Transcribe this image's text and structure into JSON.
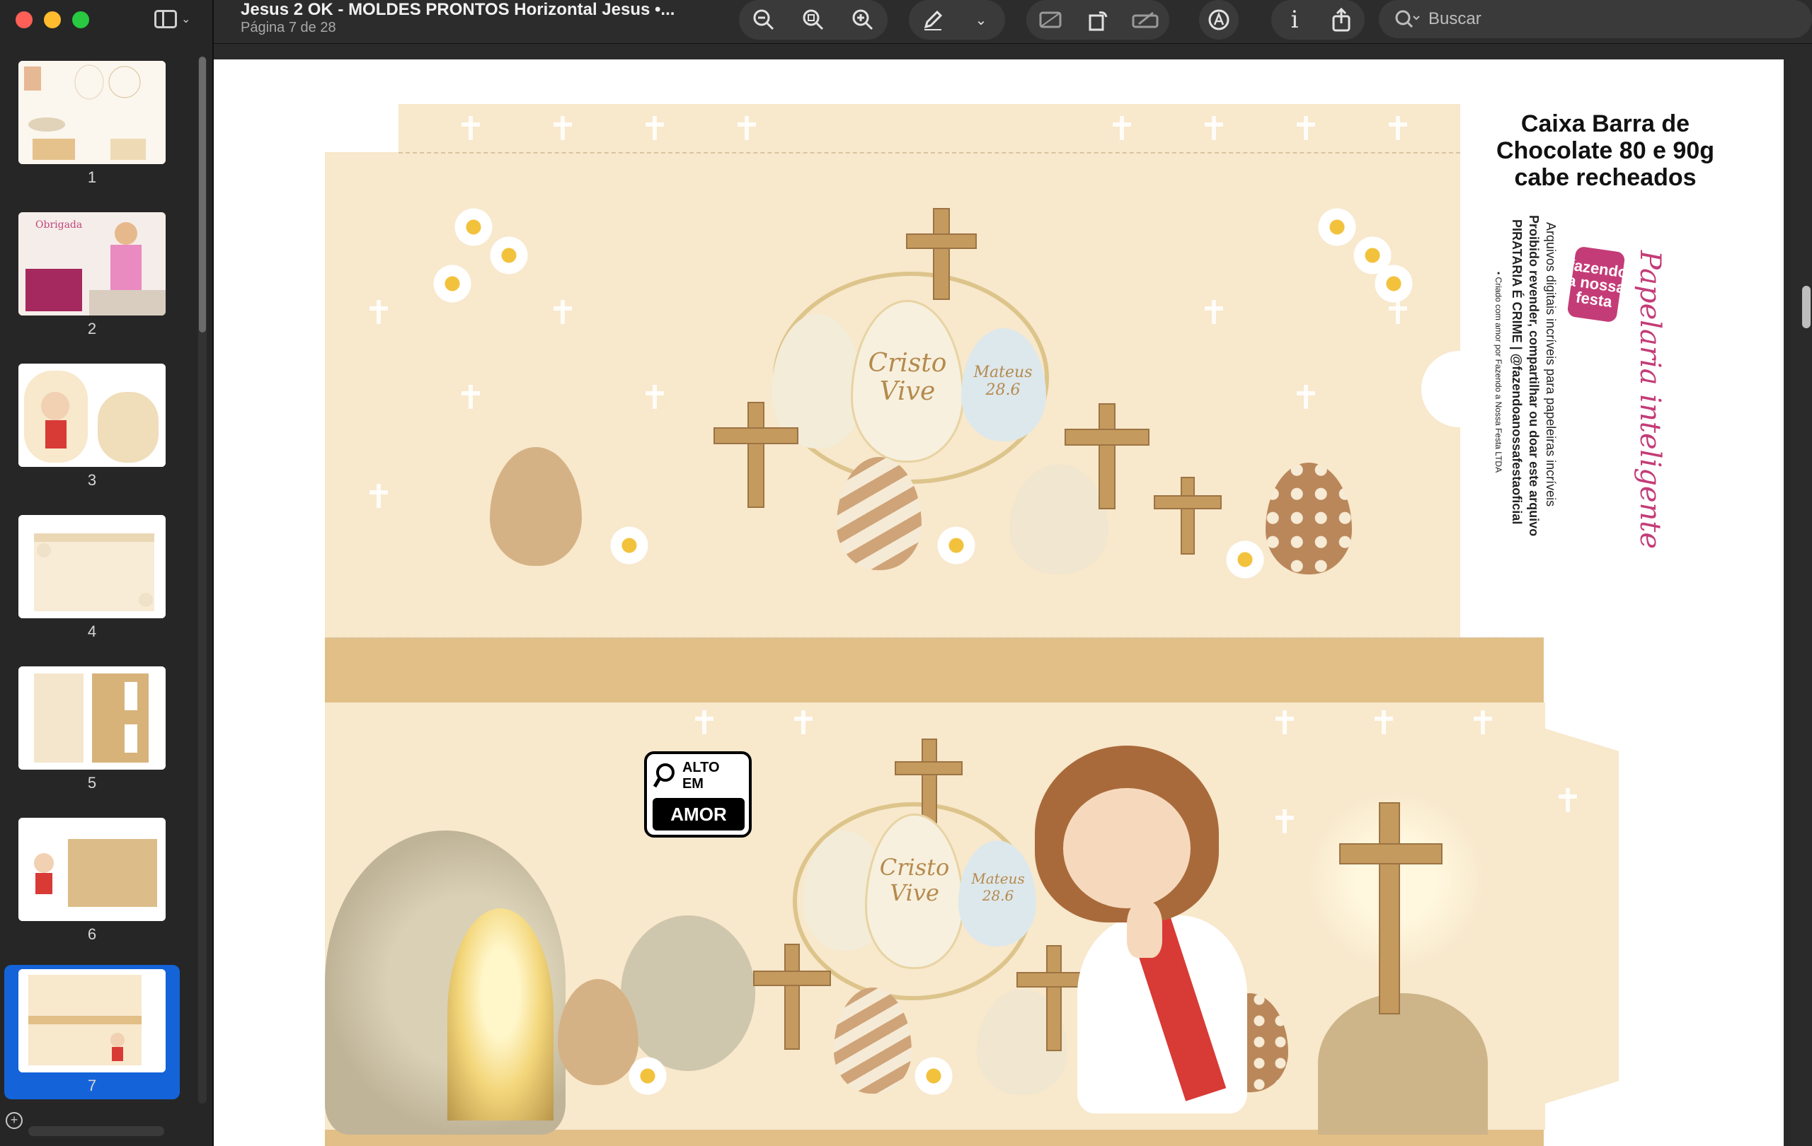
{
  "window": {
    "title": "Jesus 2 OK - MOLDES PRONTOS Horizontal Jesus •...",
    "subtitle": "Página 7 de 28",
    "search_placeholder": "Buscar"
  },
  "toolbar": {
    "icons": [
      "zoom-out-icon",
      "zoom-fit-icon",
      "zoom-in-icon",
      "markup-pen-icon",
      "chevron-down-icon",
      "crop-icon",
      "rotate-icon",
      "signature-icon",
      "annotate-icon",
      "info-icon",
      "share-icon",
      "search-icon"
    ]
  },
  "sidebar": {
    "thumbnails": [
      {
        "label": "1"
      },
      {
        "label": "2",
        "caption": "Obrigada"
      },
      {
        "label": "3"
      },
      {
        "label": "4"
      },
      {
        "label": "5"
      },
      {
        "label": "6"
      },
      {
        "label": "7",
        "selected": true
      }
    ]
  },
  "page": {
    "title_lines": [
      "Caixa Barra de",
      "Chocolate 80 e 90g",
      "cabe recheados"
    ],
    "credit_lines": [
      "Arquivos digitais incríveis para papeleiras incríveis",
      "Proibido revender, compartilhar ou doar este arquivo",
      "PIRATARIA É CRIME | @fazendoanossafestaoficial",
      "• Criado com amor por Fazendo a Nossa Festa LTDA"
    ],
    "brand_logo": "Papelaria inteligente",
    "brand_badge": "fazendo a nossa festa",
    "egg_text_top": "Cristo Vive",
    "egg_text_side": "Mateus 28.6",
    "egg_text_top_2": "Cristo Vive",
    "egg_text_side_2": "Mateus 28.6",
    "altoem_top": "ALTO EM",
    "altoem_bottom": "AMOR"
  },
  "colors": {
    "cream": "#f8e8cc",
    "tan": "#e1bf86",
    "accent_pink": "#c43c77",
    "selection_blue": "#1463d9"
  }
}
